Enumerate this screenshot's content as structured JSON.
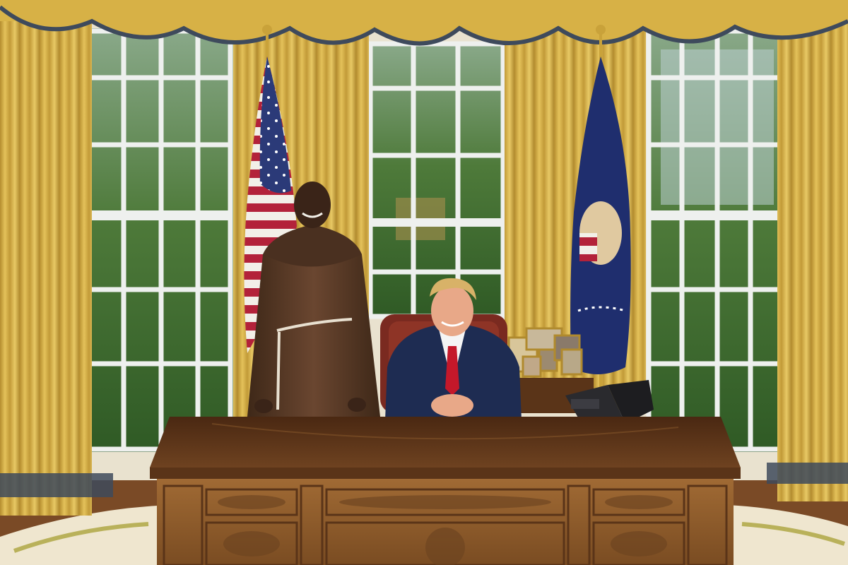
{
  "scene": {
    "description_free": true,
    "colors": {
      "curtain": "#d9b449",
      "curtain_shadow": "#a9822a",
      "valance_trim": "#3e4a5c",
      "window_frame": "#eef0ee",
      "foliage": "#4e7a3a",
      "sky": "#c8d8d6",
      "wall": "#e9e2cf",
      "floor": "#7a4a26",
      "rug": "#efe6cf",
      "desk": "#8a5a2b",
      "desk_top": "#5a3418",
      "robe": "#5a3a24",
      "suit": "#1e2c52",
      "tie": "#c4182a",
      "us_flag_blue": "#2b3a78",
      "us_flag_red": "#b3223a",
      "pres_flag": "#1f2e6e",
      "chair": "#7a2a20",
      "gold": "#c9a23a"
    },
    "icons": [
      "us-flag",
      "presidential-flag",
      "telephone",
      "picture-frames"
    ]
  }
}
